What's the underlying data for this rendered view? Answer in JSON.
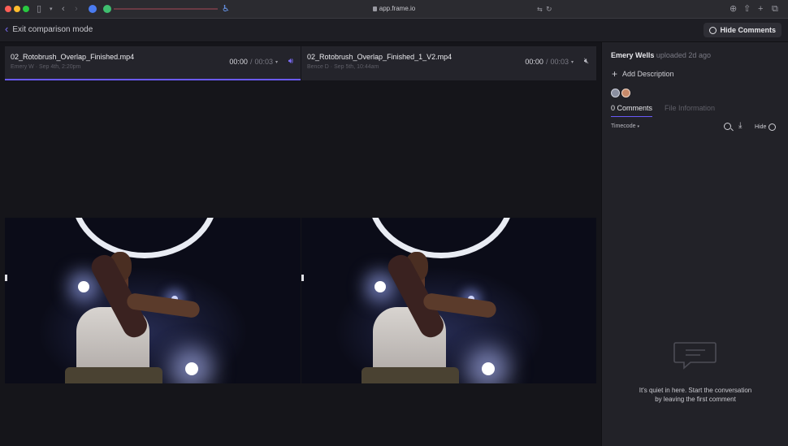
{
  "browser": {
    "url": "app.frame.io"
  },
  "topbar": {
    "exit_label": "Exit comparison mode",
    "hide_comments_label": "Hide Comments"
  },
  "panes": [
    {
      "filename": "02_Rotobrush_Overlap_Finished.mp4",
      "meta": "Emery W · Sep 4th, 2:20pm",
      "current_time": "00:00",
      "duration": "00:03",
      "audio": "on"
    },
    {
      "filename": "02_Rotobrush_Overlap_Finished_1_V2.mp4",
      "meta": "Bence D · Sep 5th, 10:44am",
      "current_time": "00:00",
      "duration": "00:03",
      "audio": "muted"
    }
  ],
  "panel": {
    "uploader_name": "Emery Wells",
    "uploader_suffix": "uploaded 2d ago",
    "add_description": "Add Description",
    "tabs": [
      {
        "label": "0 Comments",
        "active": true
      },
      {
        "label": "File Information",
        "active": false
      }
    ],
    "sort_label": "Timecode",
    "hide_label": "Hide",
    "empty_line1": "It's quiet in here. Start the conversation",
    "empty_line2": "by leaving the first comment"
  },
  "colors": {
    "accent": "#6a5af9",
    "panel_bg": "#222228",
    "viewer_bg": "#15151a"
  },
  "icons": [
    "sidebar-toggle-icon",
    "back-arrow-icon",
    "share-icon",
    "new-tab-icon",
    "tabs-icon",
    "volume-icon",
    "mute-icon",
    "search-icon",
    "download-icon",
    "check-circle-icon",
    "comment-bubble-icon"
  ]
}
